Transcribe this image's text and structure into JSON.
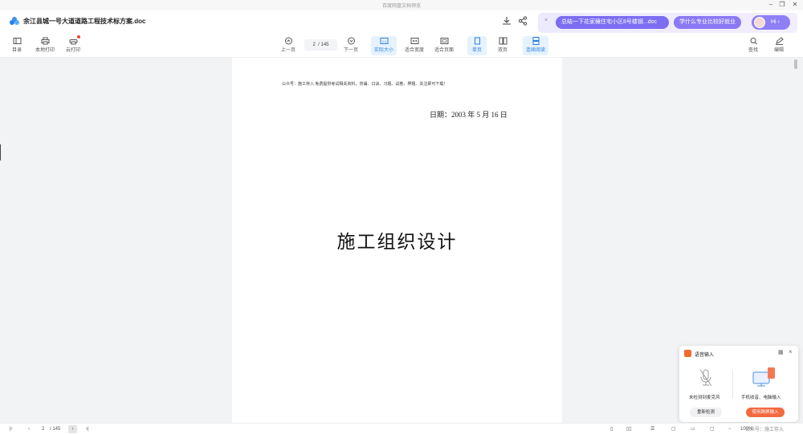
{
  "window": {
    "title": "百度网盘文档预览"
  },
  "header": {
    "doc_title": "余江县城一号大道道路工程技术标方案.doc",
    "ai": {
      "chip1": "总结一下花家穰住宅小区8号楼钢...doc",
      "chip2": "学什么专业比较好就业",
      "hi": "Hi ›",
      "close": "×"
    }
  },
  "toolbar": {
    "catalog": "目录",
    "local_print": "本地打印",
    "cloud_print": "云打印",
    "prev": "上一页",
    "page_current": "2",
    "page_total": "/ 145",
    "next": "下一页",
    "actual_size": "实际大小",
    "fit_width": "适合宽度",
    "fit_page": "适合页面",
    "single": "单页",
    "double": "双页",
    "continuous": "连续阅读",
    "search": "查找",
    "annotate": "编辑"
  },
  "document": {
    "notice": "公众号：施工存入 免费提供考试相关资料，背诵、口诀、习题、试卷、押题、关注即可下载！",
    "date": "日期：2003 年 5 月 16 日",
    "heading": "施工组织设计"
  },
  "statusbar": {
    "page": "2",
    "total": "/ 145",
    "zoom": "100%"
  },
  "voice": {
    "title": "语音输入",
    "left_label": "未检测到麦克风",
    "left_btn": "重新检测",
    "right_label": "手机收音、电脑输入",
    "right_btn": "使用跨屏输入"
  },
  "watermark": "公众号：施工存入"
}
